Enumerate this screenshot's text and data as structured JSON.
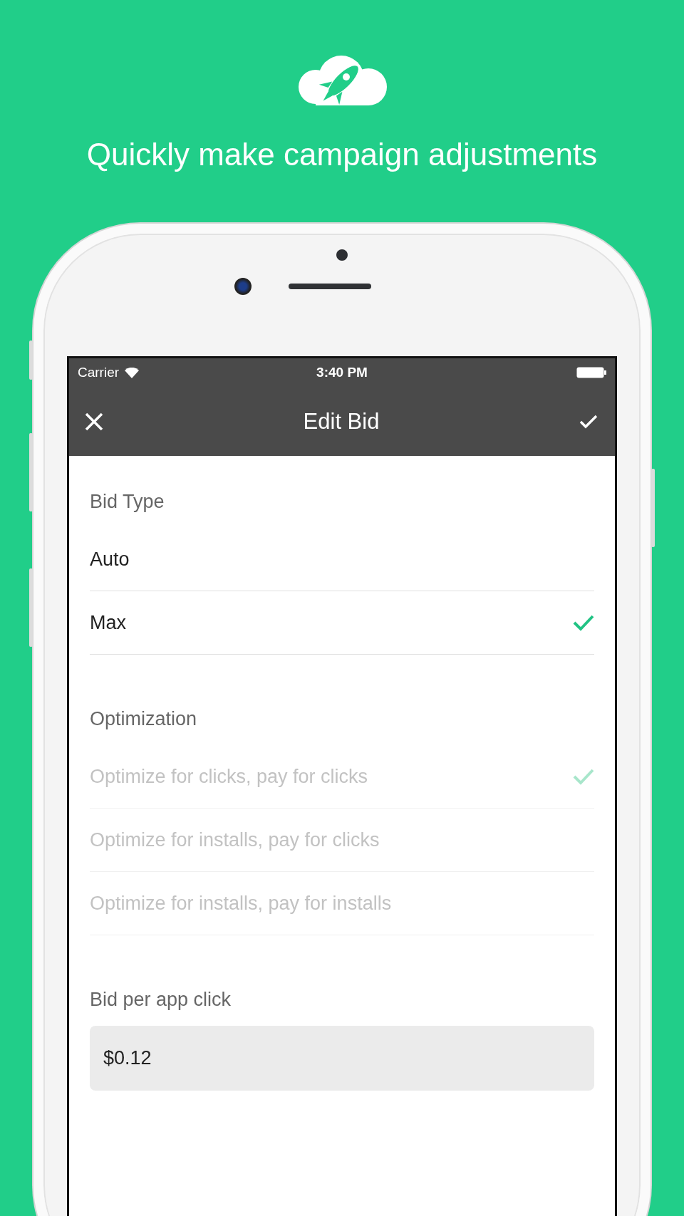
{
  "headline": "Quickly make campaign adjustments",
  "status_bar": {
    "carrier": "Carrier",
    "time": "3:40 PM"
  },
  "nav": {
    "title": "Edit Bid"
  },
  "sections": [
    {
      "label": "Bid Type",
      "disabled": false,
      "options": [
        {
          "label": "Auto",
          "selected": false
        },
        {
          "label": "Max",
          "selected": true
        }
      ]
    },
    {
      "label": "Optimization",
      "disabled": true,
      "options": [
        {
          "label": "Optimize for clicks, pay for clicks",
          "selected": true
        },
        {
          "label": "Optimize for installs, pay for clicks",
          "selected": false
        },
        {
          "label": "Optimize for installs, pay for installs",
          "selected": false
        }
      ]
    }
  ],
  "bid": {
    "label": "Bid per app click",
    "value": "$0.12"
  }
}
